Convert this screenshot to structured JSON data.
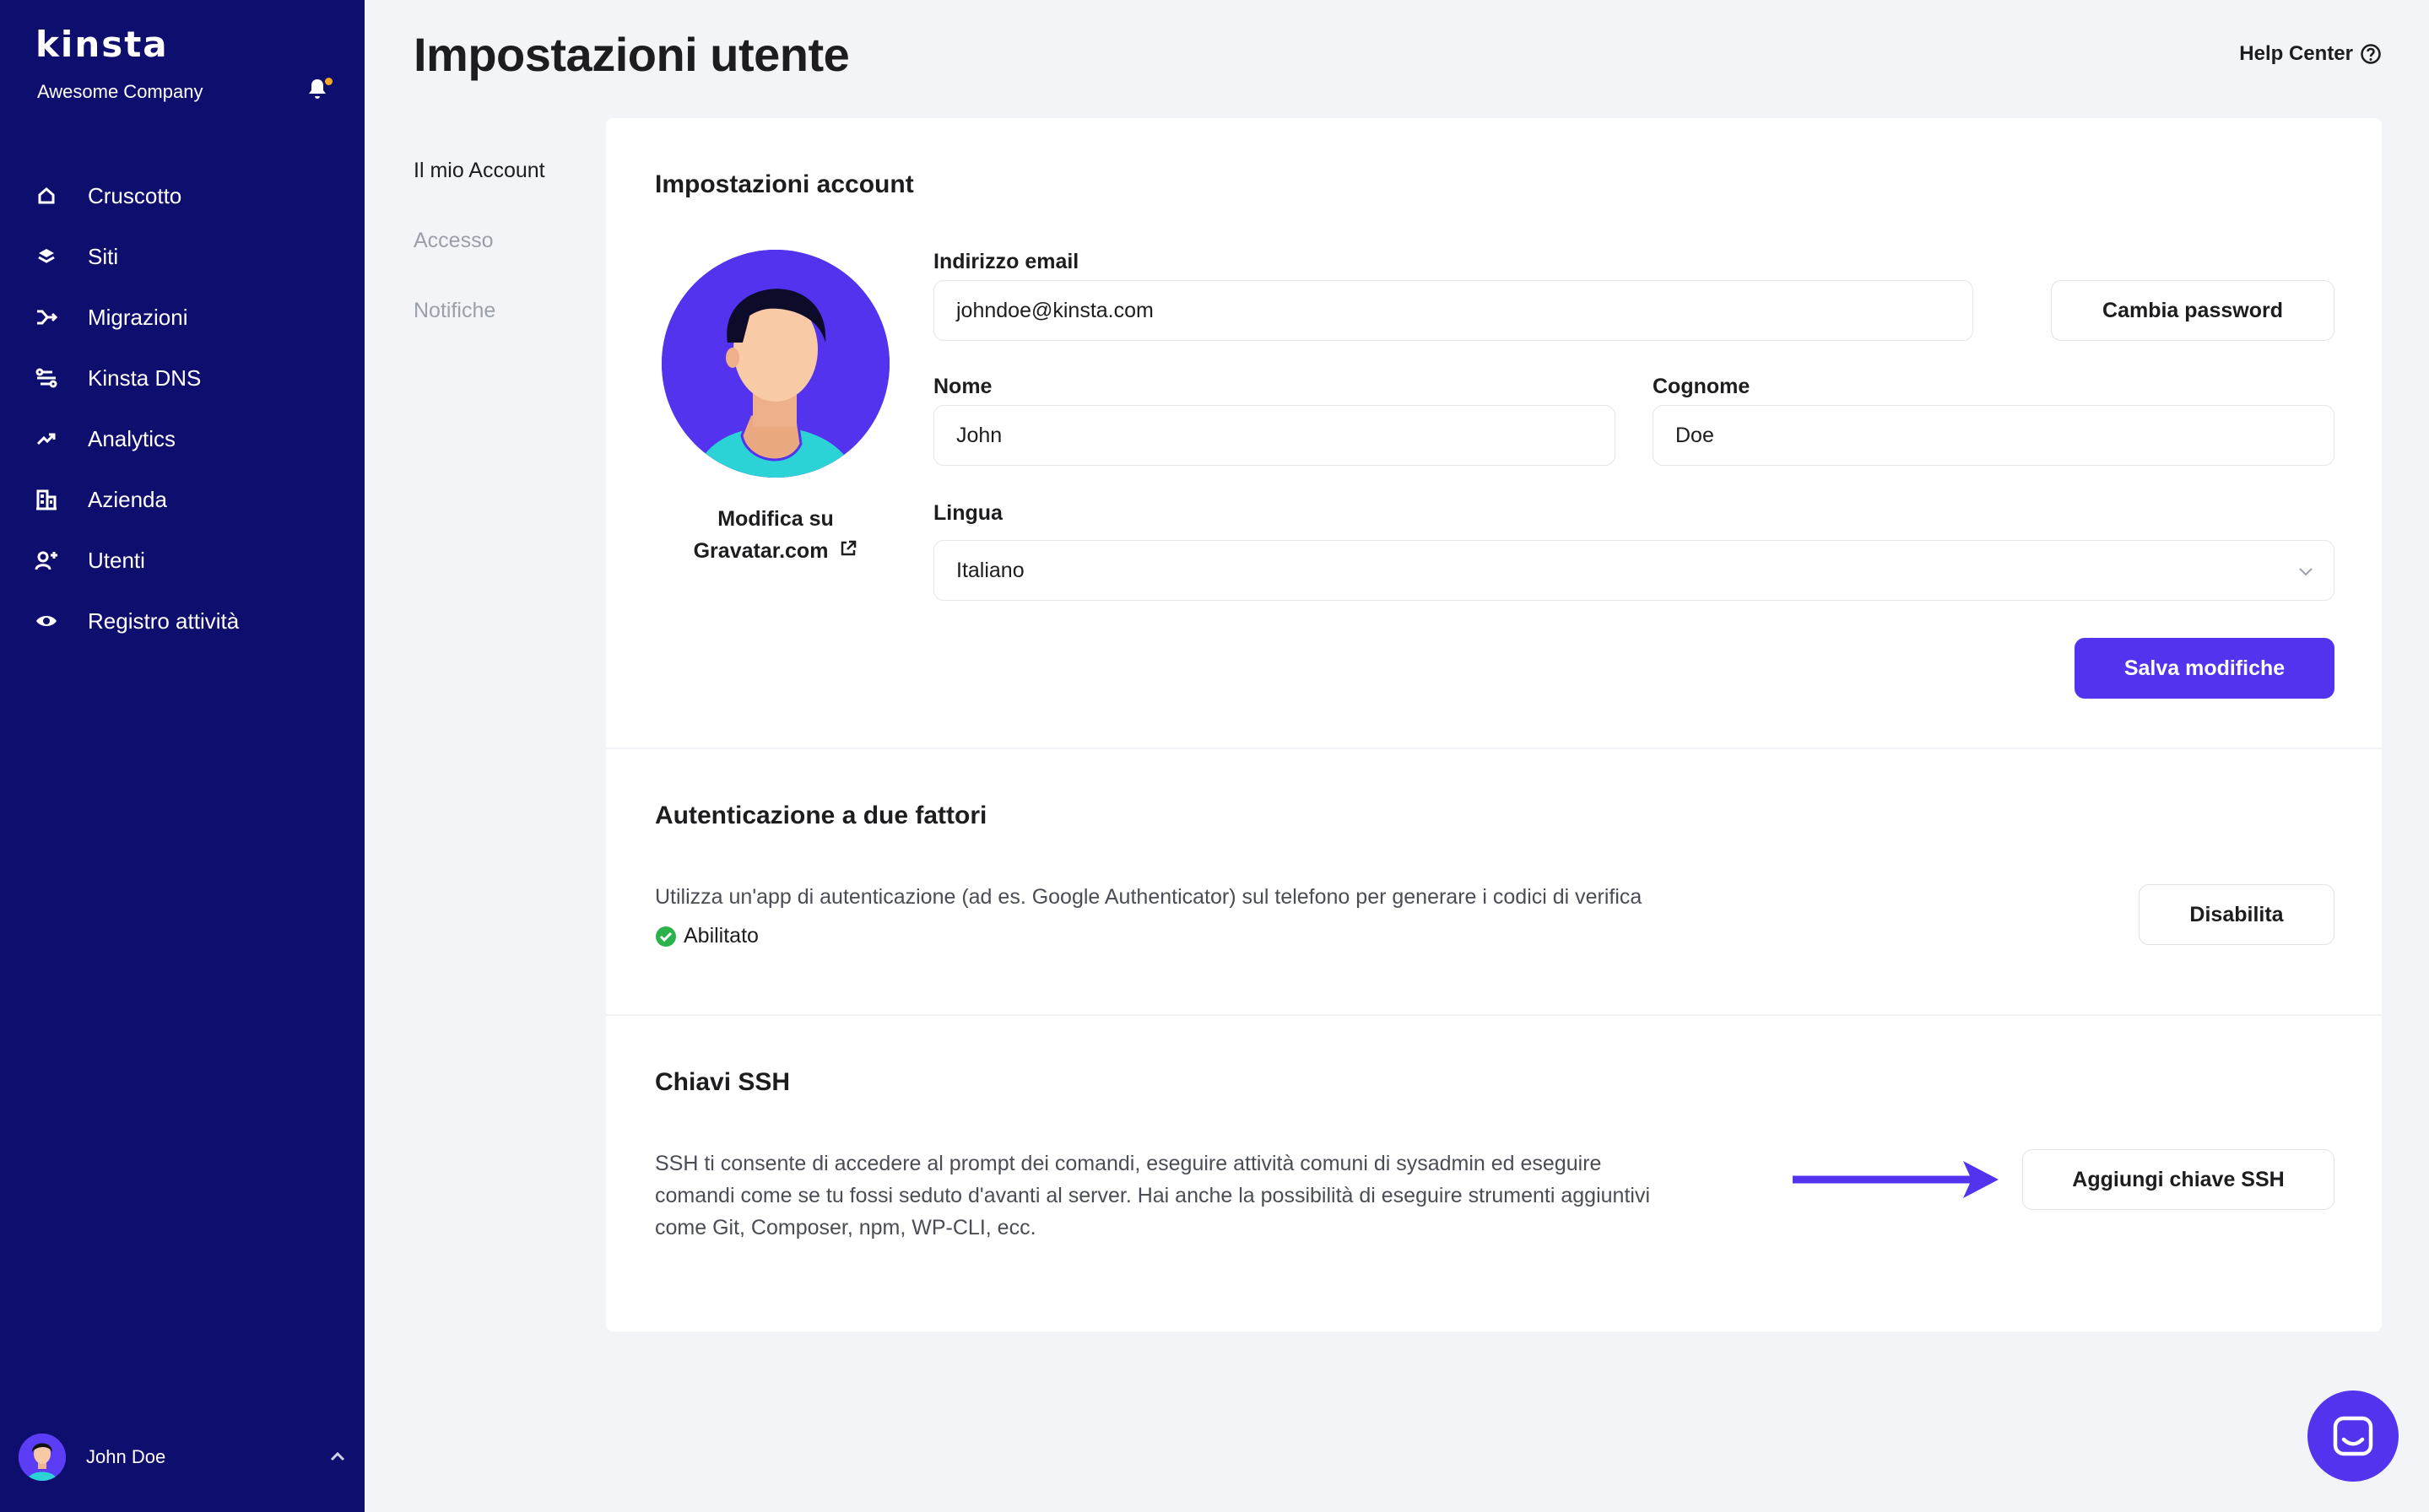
{
  "sidebar": {
    "logo": "kinsta",
    "company": "Awesome Company",
    "items": [
      {
        "label": "Cruscotto",
        "icon": "home-icon"
      },
      {
        "label": "Siti",
        "icon": "layers-icon"
      },
      {
        "label": "Migrazioni",
        "icon": "migrate-icon"
      },
      {
        "label": "Kinsta DNS",
        "icon": "dns-icon"
      },
      {
        "label": "Analytics",
        "icon": "trend-icon"
      },
      {
        "label": "Azienda",
        "icon": "building-icon"
      },
      {
        "label": "Utenti",
        "icon": "user-add-icon"
      },
      {
        "label": "Registro attività",
        "icon": "eye-icon"
      }
    ],
    "user_name": "John Doe"
  },
  "header": {
    "title": "Impostazioni utente",
    "help": "Help Center"
  },
  "subnav": {
    "items": [
      "Il mio Account",
      "Accesso",
      "Notifiche"
    ]
  },
  "account": {
    "title": "Impostazioni account",
    "gravatar_line1": "Modifica su",
    "gravatar_line2": "Gravatar.com",
    "email_label": "Indirizzo email",
    "email_value": "johndoe@kinsta.com",
    "change_password": "Cambia password",
    "first_name_label": "Nome",
    "first_name_value": "John",
    "last_name_label": "Cognome",
    "last_name_value": "Doe",
    "language_label": "Lingua",
    "language_value": "Italiano",
    "save": "Salva modifiche"
  },
  "twofa": {
    "title": "Autenticazione a due fattori",
    "description": "Utilizza un'app di autenticazione (ad es. Google Authenticator) sul telefono per generare i codici di verifica",
    "status": "Abilitato",
    "disable": "Disabilita"
  },
  "ssh": {
    "title": "Chiavi SSH",
    "line1": "SSH ti consente di accedere al prompt dei comandi, eseguire attività comuni di sysadmin ed eseguire",
    "line2": "comandi come se tu fossi seduto d'avanti al server. Hai anche la possibilità di eseguire strumenti aggiuntivi",
    "line3": "come Git, Composer, npm, WP-CLI, ecc.",
    "add": "Aggiungi chiave SSH"
  },
  "colors": {
    "sidebar": "#0e0e6e",
    "accent": "#5333ed",
    "success": "#2bb24c",
    "background": "#f3f4f8"
  }
}
